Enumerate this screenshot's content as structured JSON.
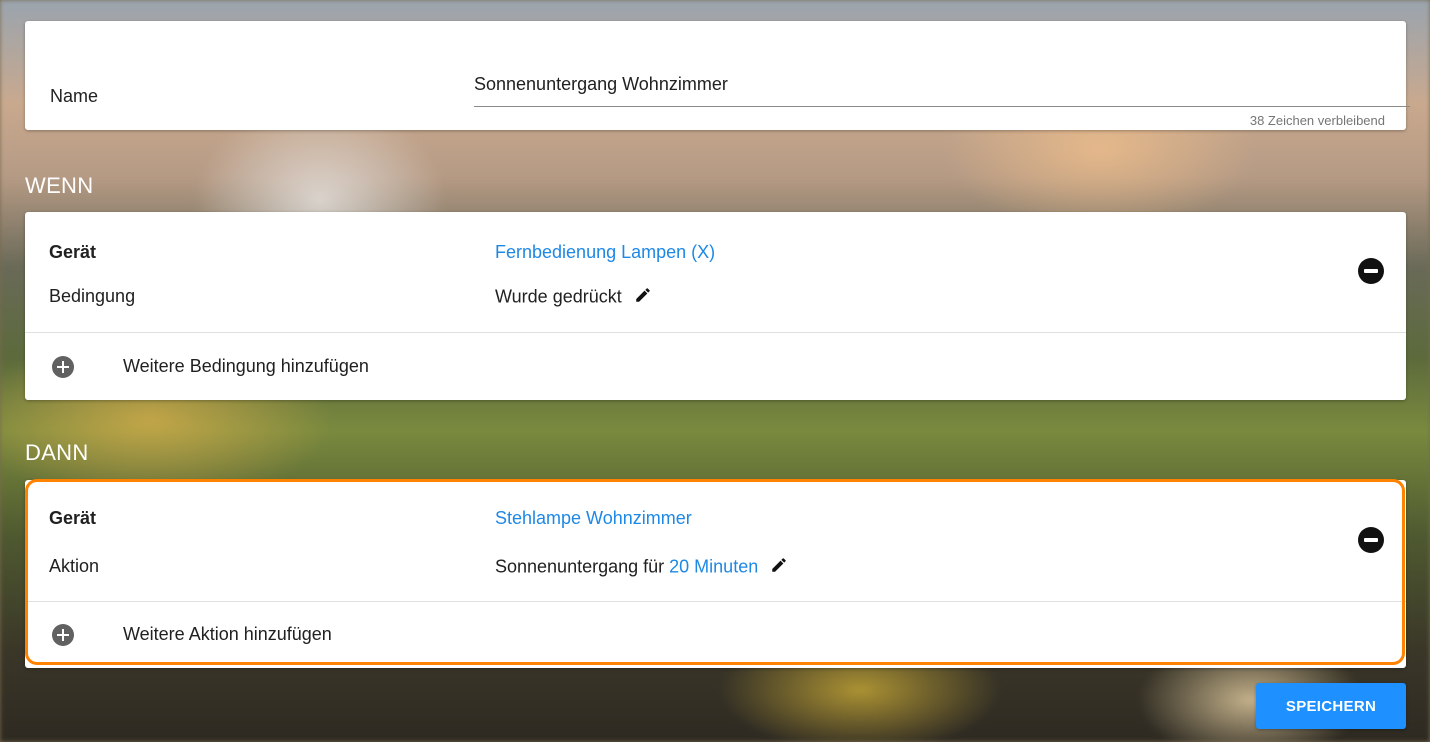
{
  "name": {
    "label": "Name",
    "value": "Sonnenuntergang Wohnzimmer",
    "counter": "38 Zeichen verbleibend"
  },
  "wenn": {
    "title": "WENN",
    "device_label": "Gerät",
    "device_value": "Fernbedienung Lampen (X)",
    "condition_label": "Bedingung",
    "condition_value": "Wurde gedrückt",
    "add_label": "Weitere Bedingung hinzufügen"
  },
  "dann": {
    "title": "DANN",
    "device_label": "Gerät",
    "device_value": "Stehlampe Wohnzimmer",
    "action_label": "Aktion",
    "action_prefix": "Sonnenuntergang für",
    "action_duration": "20 Minuten",
    "add_label": "Weitere Aktion hinzufügen"
  },
  "save_label": "SPEICHERN",
  "colors": {
    "link": "#1e88e5",
    "highlight": "#ff8200",
    "primary_button": "#1e90ff"
  },
  "icons": {
    "remove": "minus-circle-icon",
    "add": "plus-circle-icon",
    "edit": "pencil-icon"
  }
}
